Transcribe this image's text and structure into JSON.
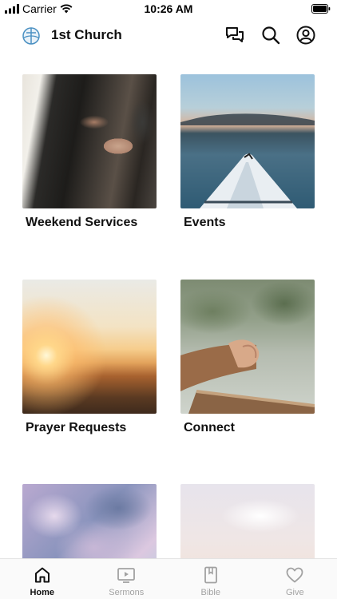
{
  "status_bar": {
    "carrier": "Carrier",
    "time": "10:26 AM"
  },
  "header": {
    "title": "1st Church",
    "icons": [
      "church-logo-icon",
      "chat-icon",
      "search-icon",
      "account-icon"
    ]
  },
  "tiles": [
    {
      "label": "Weekend Services",
      "image": "worship-hands-photo"
    },
    {
      "label": "Events",
      "image": "kayak-lake-photo"
    },
    {
      "label": "Prayer Requests",
      "image": "sunrise-mountains-photo"
    },
    {
      "label": "Connect",
      "image": "folded-hands-photo"
    },
    {
      "label": "",
      "image": "clouds-sky-photo"
    },
    {
      "label": "",
      "image": "hazy-sky-photo"
    }
  ],
  "tab_bar": {
    "items": [
      {
        "label": "Home",
        "icon": "home-icon",
        "active": true
      },
      {
        "label": "Sermons",
        "icon": "play-screen-icon",
        "active": false
      },
      {
        "label": "Bible",
        "icon": "book-icon",
        "active": false
      },
      {
        "label": "Give",
        "icon": "heart-icon",
        "active": false
      }
    ]
  },
  "colors": {
    "text": "#111111",
    "tab_inactive": "#a2a2a2",
    "logo_accent": "#4a90c2"
  }
}
